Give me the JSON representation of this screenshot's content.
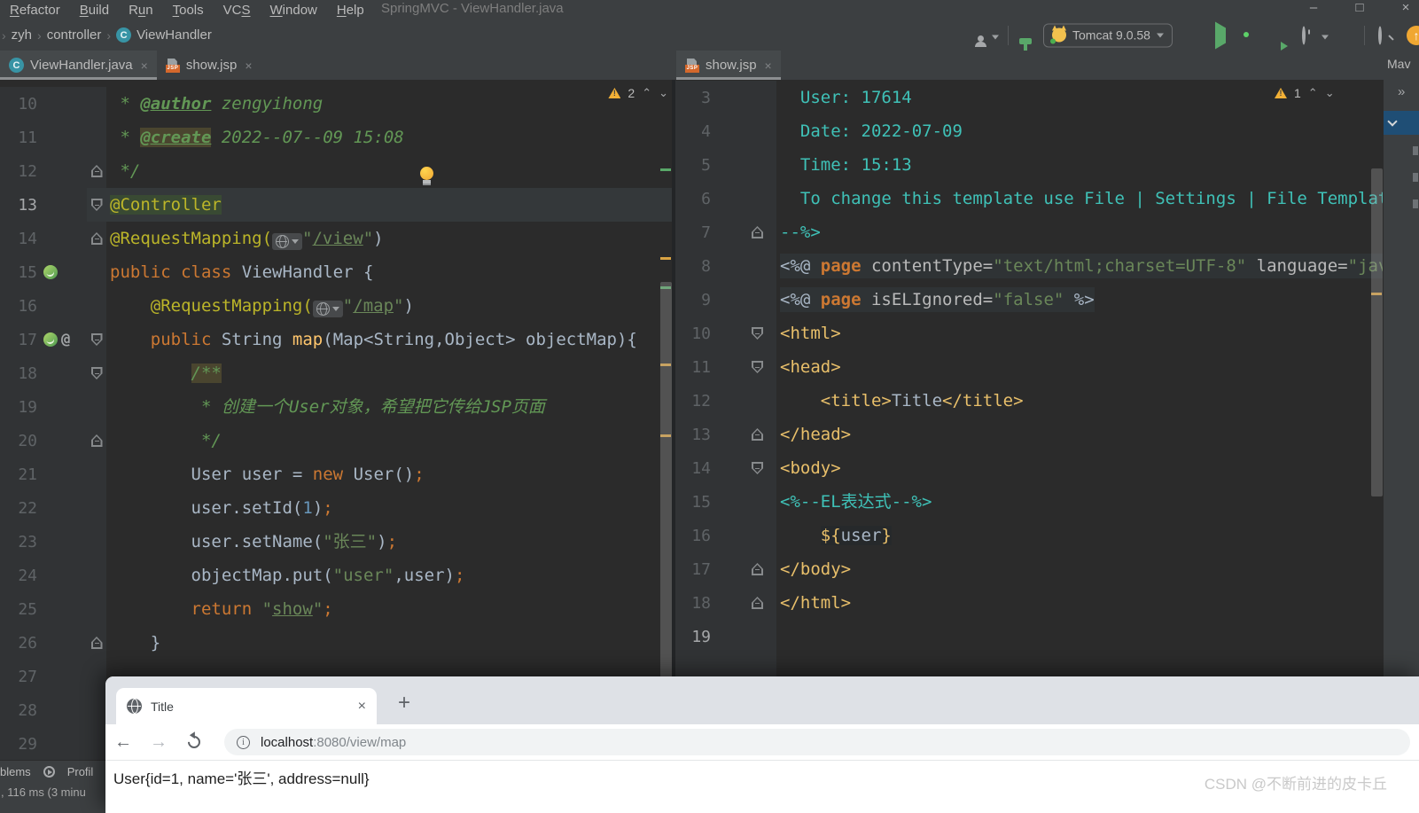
{
  "menu": {
    "items": [
      {
        "pre": "",
        "mn": "R",
        "post": "efactor"
      },
      {
        "pre": "",
        "mn": "B",
        "post": "uild"
      },
      {
        "pre": "R",
        "mn": "u",
        "post": "n"
      },
      {
        "pre": "",
        "mn": "T",
        "post": "ools"
      },
      {
        "pre": "VC",
        "mn": "S",
        "post": ""
      },
      {
        "pre": "",
        "mn": "W",
        "post": "indow"
      },
      {
        "pre": "",
        "mn": "H",
        "post": "elp"
      }
    ],
    "title": "SpringMVC - ViewHandler.java",
    "window_controls": [
      "–",
      "□",
      "×"
    ]
  },
  "breadcrumbs": [
    "zyh",
    "controller",
    "ViewHandler"
  ],
  "run_bar": {
    "tomcat_label": "Tomcat 9.0.58"
  },
  "tabs": {
    "left_group": [
      {
        "label": "ViewHandler.java",
        "icon": "class",
        "active": true,
        "close": "×"
      },
      {
        "label": "show.jsp",
        "icon": "jsp",
        "active": false,
        "close": "×"
      }
    ],
    "right_group": [
      {
        "label": "show.jsp",
        "icon": "jsp",
        "active": true,
        "close": "×"
      }
    ]
  },
  "maven": {
    "label": "Mav",
    "more": "»"
  },
  "editors": {
    "left": {
      "warn_count": "2",
      "lines": [
        {
          "n": "10",
          "t": [
            [
              " * ",
              "cmt"
            ],
            [
              "@author",
              "doctag"
            ],
            [
              " zengyihong",
              "cmt"
            ]
          ]
        },
        {
          "n": "11",
          "t": [
            [
              " * ",
              "cmt"
            ],
            [
              "@create",
              "doctag hlO"
            ],
            [
              " 2022--07--09 15:08",
              "cmt"
            ]
          ]
        },
        {
          "n": "12",
          "fold": "fe",
          "t": [
            [
              " */",
              "cmt"
            ]
          ]
        },
        {
          "n": "13",
          "fold": "fs",
          "cur": true,
          "hl": true,
          "t": [
            [
              "@Controller",
              "ann hlG"
            ]
          ]
        },
        {
          "n": "14",
          "fold": "fe",
          "t": [
            [
              "@RequestMapping(",
              "ann"
            ],
            [
              "",
              "globe"
            ],
            [
              "\"",
              "str"
            ],
            [
              "/view",
              "strU"
            ],
            [
              "\"",
              "str"
            ],
            [
              ")",
              "id"
            ]
          ]
        },
        {
          "n": "15",
          "icons": [
            "leaf"
          ],
          "t": [
            [
              "public class",
              "kw"
            ],
            [
              " ViewHandler {",
              "id"
            ]
          ]
        },
        {
          "n": "16",
          "t": [
            [
              "    ",
              ""
            ],
            [
              "@RequestMapping(",
              "ann"
            ],
            [
              "",
              "globe"
            ],
            [
              "\"",
              "str"
            ],
            [
              "/map",
              "strU"
            ],
            [
              "\"",
              "str"
            ],
            [
              ")",
              "id"
            ]
          ]
        },
        {
          "n": "17",
          "icons": [
            "leaf",
            "at"
          ],
          "fold": "fs",
          "t": [
            [
              "    ",
              ""
            ],
            [
              "public",
              "kw"
            ],
            [
              " String ",
              "id"
            ],
            [
              "map",
              "meth"
            ],
            [
              "(Map<String,Object> objectMap){",
              "id"
            ]
          ]
        },
        {
          "n": "18",
          "fold": "fs",
          "t": [
            [
              "        ",
              ""
            ],
            [
              "/**",
              "cmt hlO"
            ]
          ]
        },
        {
          "n": "19",
          "t": [
            [
              "         * 创建一个User对象，希望把它传给JSP页面",
              "cmt"
            ]
          ]
        },
        {
          "n": "20",
          "fold": "fe",
          "t": [
            [
              "         */",
              "cmt"
            ]
          ]
        },
        {
          "n": "21",
          "t": [
            [
              "        ",
              ""
            ],
            [
              "User user = ",
              "id"
            ],
            [
              "new",
              "kw"
            ],
            [
              " User()",
              "id"
            ],
            [
              ";",
              "semi"
            ]
          ]
        },
        {
          "n": "22",
          "t": [
            [
              "        ",
              ""
            ],
            [
              "user.setId(",
              "id"
            ],
            [
              "1",
              "num"
            ],
            [
              ")",
              "id"
            ],
            [
              ";",
              "semi"
            ]
          ]
        },
        {
          "n": "23",
          "t": [
            [
              "        ",
              ""
            ],
            [
              "user.setName(",
              "id"
            ],
            [
              "\"张三\"",
              "str"
            ],
            [
              ")",
              "id"
            ],
            [
              ";",
              "semi"
            ]
          ]
        },
        {
          "n": "24",
          "t": [
            [
              "        ",
              ""
            ],
            [
              "objectMap.put(",
              "id"
            ],
            [
              "\"user\"",
              "str"
            ],
            [
              ",user)",
              "id"
            ],
            [
              ";",
              "semi"
            ]
          ]
        },
        {
          "n": "25",
          "t": [
            [
              "        ",
              ""
            ],
            [
              "return ",
              "kw"
            ],
            [
              "\"",
              "str"
            ],
            [
              "show",
              "strU"
            ],
            [
              "\"",
              "str"
            ],
            [
              ";",
              "semi"
            ]
          ]
        },
        {
          "n": "26",
          "fold": "fe",
          "t": [
            [
              "    }",
              "id"
            ]
          ]
        },
        {
          "n": "27",
          "t": []
        },
        {
          "n": "28",
          "t": []
        },
        {
          "n": "29",
          "t": []
        }
      ]
    },
    "right": {
      "warn_count": "1",
      "lines": [
        {
          "n": "3",
          "t": [
            [
              "  User: 17614",
              "cy"
            ]
          ]
        },
        {
          "n": "4",
          "t": [
            [
              "  Date: 2022-07-09",
              "cy"
            ]
          ]
        },
        {
          "n": "5",
          "t": [
            [
              "  Time: 15:13",
              "cy"
            ]
          ]
        },
        {
          "n": "6",
          "t": [
            [
              "  To change this template use File | Settings | File Templates.",
              "cy"
            ]
          ]
        },
        {
          "n": "7",
          "fold": "fe",
          "t": [
            [
              "--%>",
              "cy"
            ]
          ]
        },
        {
          "n": "8",
          "box": true,
          "t": [
            [
              "<%@ ",
              "id"
            ],
            [
              "page",
              "kwB"
            ],
            [
              " contentType=",
              "attr"
            ],
            [
              "\"text/html;charset=UTF-8\"",
              "str"
            ],
            [
              " language=",
              "attr"
            ],
            [
              "\"java\"",
              "str"
            ],
            [
              " %>",
              "id"
            ]
          ]
        },
        {
          "n": "9",
          "box": true,
          "t": [
            [
              "<%@ ",
              "id"
            ],
            [
              "page",
              "kwB"
            ],
            [
              " isELIgnored=",
              "attr"
            ],
            [
              "\"false\"",
              "str"
            ],
            [
              " %>",
              "id"
            ]
          ]
        },
        {
          "n": "10",
          "fold": "fs",
          "t": [
            [
              "<html>",
              "jtag"
            ]
          ]
        },
        {
          "n": "11",
          "fold": "fs",
          "t": [
            [
              "<head>",
              "jtag"
            ]
          ]
        },
        {
          "n": "12",
          "t": [
            [
              "    <title>",
              "jtag"
            ],
            [
              "Title",
              "id"
            ],
            [
              "</title>",
              "jtag"
            ]
          ]
        },
        {
          "n": "13",
          "fold": "fe",
          "t": [
            [
              "</head>",
              "jtag"
            ]
          ]
        },
        {
          "n": "14",
          "fold": "fs",
          "t": [
            [
              "<body>",
              "jtag"
            ]
          ]
        },
        {
          "n": "15",
          "t": [
            [
              "<%--EL表达式--%>",
              "cy"
            ]
          ]
        },
        {
          "n": "16",
          "t": [
            [
              "    ",
              ""
            ],
            [
              "${",
              "el elbg"
            ],
            [
              "user",
              "id elbg"
            ],
            [
              "}",
              "el elbg"
            ]
          ]
        },
        {
          "n": "17",
          "fold": "fe",
          "t": [
            [
              "</body>",
              "jtag"
            ]
          ]
        },
        {
          "n": "18",
          "fold": "fe",
          "t": [
            [
              "</html>",
              "jtag"
            ]
          ]
        },
        {
          "n": "19",
          "cur": true,
          "t": []
        }
      ]
    }
  },
  "statusbar": {
    "problems": "blems",
    "profiler": "Profil",
    "message": ", 116 ms (3 minu"
  },
  "browser": {
    "tab_title": "Title",
    "new_tab": "+",
    "url_host": "localhost",
    "url_rest": ":8080/view/map",
    "content": "User{id=1, name='张三', address=null}",
    "watermark": "CSDN @不断前进的皮卡丘"
  },
  "colors": {
    "ide_bar": "#3C3F41",
    "editor_bg": "#2B2B2B",
    "gutter_bg": "#313335",
    "keyword": "#CC7832",
    "string": "#6A8759",
    "comment": "#629755",
    "annotation": "#BBB529",
    "jsp_comment": "#3FC1B7",
    "tag": "#E8BF6A",
    "warning": "#F2B036",
    "run_green": "#59A869",
    "stop_red": "#C75450",
    "maven_selected_row": "#1F4E75"
  }
}
